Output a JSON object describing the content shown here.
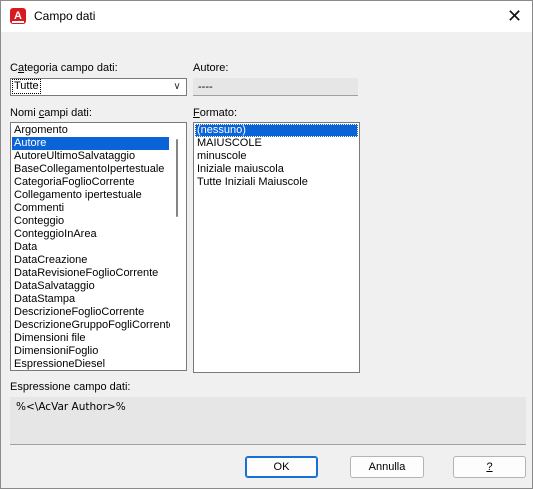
{
  "window": {
    "title": "Campo dati",
    "app_icon_letter": "A"
  },
  "category": {
    "label_prefix": "C",
    "label_accel": "a",
    "label_rest": "tegoria campo dati:",
    "selected": "Tutte"
  },
  "author": {
    "label": "Autore:",
    "value": "----"
  },
  "fields": {
    "label_prefix": "Nomi ",
    "label_accel": "c",
    "label_rest": "ampi dati:",
    "items": [
      "Argomento",
      "Autore",
      "AutoreUltimoSalvataggio",
      "BaseCollegamentoIpertestuale",
      "CategoriaFoglioCorrente",
      "Collegamento ipertestuale",
      "Commenti",
      "Conteggio",
      "ConteggioInArea",
      "Data",
      "DataCreazione",
      "DataRevisioneFoglioCorrente",
      "DataSalvataggio",
      "DataStampa",
      "DescrizioneFoglioCorrente",
      "DescrizioneGruppoFogliCorrente",
      "Dimensioni file",
      "DimensioniFoglio",
      "EspressioneDiesel"
    ],
    "selected_index": 1
  },
  "format": {
    "label_accel": "F",
    "label_rest": "ormato:",
    "items": [
      "(nessuno)",
      "MAIUSCOLE",
      "minuscole",
      "Iniziale maiuscola",
      "Tutte Iniziali Maiuscole"
    ],
    "selected_index": 0
  },
  "expression": {
    "label": "Espressione campo dati:",
    "value": "%<\\AcVar Author>%"
  },
  "buttons": {
    "ok": "OK",
    "cancel": "Annulla",
    "help": "?"
  },
  "colors": {
    "selection": "#0a64d8",
    "default_button_border": "#1a6fd6",
    "app_icon": "#d71920"
  }
}
